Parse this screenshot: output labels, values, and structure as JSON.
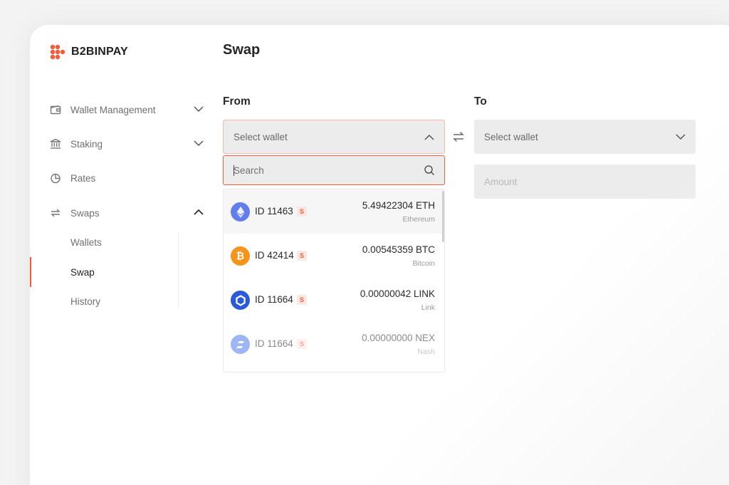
{
  "brand": {
    "name": "B2BINPAY",
    "accent": "#f25c3b"
  },
  "sidebar": {
    "items": [
      {
        "label": "Wallet Management",
        "icon": "wallet-icon",
        "expanded": false
      },
      {
        "label": "Staking",
        "icon": "bank-icon",
        "expanded": false
      },
      {
        "label": "Rates",
        "icon": "pie-chart-icon"
      },
      {
        "label": "Swaps",
        "icon": "swap-arrows-icon",
        "expanded": true
      }
    ],
    "swaps_children": [
      {
        "label": "Wallets"
      },
      {
        "label": "Swap",
        "active": true
      },
      {
        "label": "History"
      }
    ]
  },
  "main": {
    "title": "Swap",
    "from": {
      "label": "From",
      "select_placeholder": "Select wallet",
      "search_placeholder": "Search",
      "wallets": [
        {
          "id": "ID 11463",
          "badge": "S",
          "amount": "5.49422304 ETH",
          "network": "Ethereum",
          "icon": "ethereum-icon",
          "color": "#627eea"
        },
        {
          "id": "ID 42414",
          "badge": "S",
          "amount": "0.00545359 BTC",
          "network": "Bitcoin",
          "icon": "bitcoin-icon",
          "color": "#f7931a"
        },
        {
          "id": "ID 11664",
          "badge": "S",
          "amount": "0.00000042 LINK",
          "network": "Link",
          "icon": "chainlink-icon",
          "color": "#2a5ada"
        },
        {
          "id": "ID 11664",
          "badge": "S",
          "amount": "0.00000000 NEX",
          "network": "Nash",
          "icon": "nash-icon",
          "color": "#4f7cf0"
        }
      ]
    },
    "to": {
      "label": "To",
      "select_placeholder": "Select wallet",
      "amount_placeholder": "Amount"
    }
  }
}
